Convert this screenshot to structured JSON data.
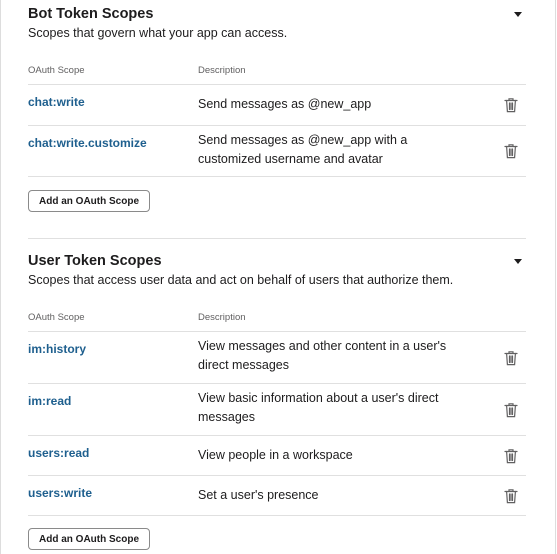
{
  "bot_section": {
    "title": "Bot Token Scopes",
    "subtitle": "Scopes that govern what your app can access.",
    "columns": {
      "scope": "OAuth Scope",
      "description": "Description"
    },
    "rows": [
      {
        "scope": "chat:write",
        "description": "Send messages as @new_app"
      },
      {
        "scope": "chat:write.customize",
        "description": "Send messages as @new_app with a customized username and avatar"
      }
    ],
    "add_button": "Add an OAuth Scope"
  },
  "user_section": {
    "title": "User Token Scopes",
    "subtitle": "Scopes that access user data and act on behalf of users that authorize them.",
    "columns": {
      "scope": "OAuth Scope",
      "description": "Description"
    },
    "rows": [
      {
        "scope": "im:history",
        "description": "View messages and other content in a user's direct messages"
      },
      {
        "scope": "im:read",
        "description": "View basic information about a user's direct messages"
      },
      {
        "scope": "users:read",
        "description": "View people in a workspace"
      },
      {
        "scope": "users:write",
        "description": "Set a user's presence"
      }
    ],
    "add_button": "Add an OAuth Scope"
  },
  "icons": {
    "row_action": "trash-icon",
    "collapse": "caret-down-icon"
  },
  "colors": {
    "scope_link": "#1e5f8e",
    "text": "#1d1c1d",
    "muted": "#616061",
    "border": "#e0e0e0"
  }
}
